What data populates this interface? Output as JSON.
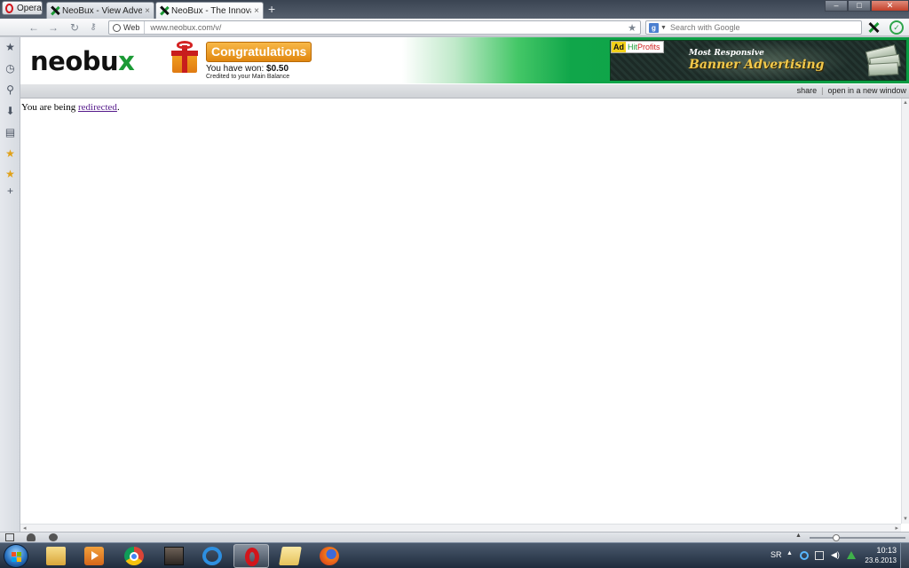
{
  "browser": {
    "menu_label": "Opera",
    "tabs": [
      {
        "title": "NeoBux - View Advertis...",
        "active": false
      },
      {
        "title": "NeoBux - The Innovati...",
        "active": true
      }
    ],
    "new_tab_label": "+",
    "tab_close_glyph": "×",
    "address": {
      "scheme_label": "Web",
      "url": "www.neobux.com/v/"
    },
    "search": {
      "engine_letter": "g",
      "placeholder": "Search with Google"
    },
    "window_controls": {
      "minimize": "–",
      "maximize": "□",
      "close": "✕"
    }
  },
  "panel": {
    "icons": [
      "bookmarks-star-icon",
      "history-clock-icon",
      "search-icon",
      "downloads-icon",
      "notes-icon",
      "favorite-star-icon",
      "favorite-star-icon",
      "add-panel-icon"
    ]
  },
  "page": {
    "logo": {
      "text_main": "neobu",
      "text_x": "x"
    },
    "reward": {
      "title": "Congratulations",
      "won_prefix": "You have won: ",
      "won_amount": "$0.50",
      "credited": "Credited to your Main Balance"
    },
    "ad": {
      "badge": "Ad",
      "brand_hit": "Hit",
      "brand_profits": "Profits",
      "small_line": "Most Responsive",
      "big_line": "Banner Advertising"
    },
    "share_bar": {
      "share": "share",
      "separator": "|",
      "open_new_window": "open in a new window"
    },
    "redirect": {
      "prefix": "You are being ",
      "link": "redirected",
      "suffix": "."
    }
  },
  "taskbar": {
    "apps": [
      "windows-explorer-icon",
      "media-player-icon",
      "chrome-icon",
      "game-app-icon",
      "internet-explorer-icon",
      "opera-icon",
      "folder-icon",
      "firefox-icon"
    ],
    "active_app": "opera-icon",
    "tray": {
      "language": "SR",
      "time": "10:13",
      "date": "23.6.2013"
    }
  },
  "colors": {
    "neobux_green": "#1b9a35",
    "congrats_orange": "#f0a024",
    "visited_link": "#551a8b"
  }
}
